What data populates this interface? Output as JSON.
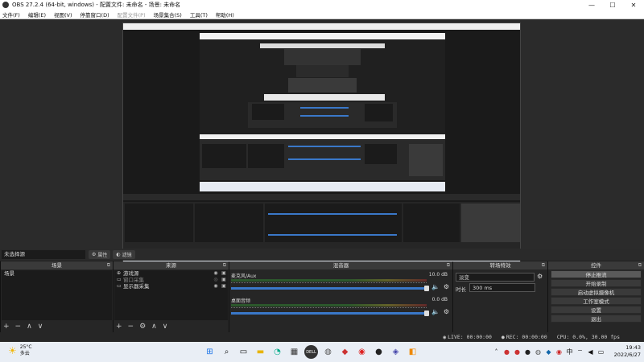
{
  "window": {
    "title": "OBS 27.2.4 (64-bit, windows) - 配置文件: 未命名 - 场景: 未命名",
    "controls": [
      "—",
      "☐",
      "✕"
    ]
  },
  "menu": {
    "items": [
      "文件(F)",
      "编辑(E)",
      "视图(V)",
      "停靠窗口(D)",
      "配置文件(P)",
      "场景集合(S)",
      "工具(T)",
      "帮助(H)"
    ]
  },
  "scene_bar": {
    "no_scene": "未选择源",
    "properties": "属性",
    "filters": "滤镜"
  },
  "docks": {
    "scenes": {
      "title": "场景",
      "items": [
        "场景"
      ]
    },
    "sources": {
      "title": "来源",
      "items": [
        {
          "label": "游戏源",
          "icon": "gamepad-icon"
        },
        {
          "label": "窗口采集",
          "icon": "window-icon"
        },
        {
          "label": "显示器采集",
          "icon": "monitor-icon"
        }
      ]
    },
    "mixer": {
      "title": "混音器",
      "tracks": [
        {
          "name": "麦克风/Aux",
          "db": "10.0 dB"
        },
        {
          "name": "桌面音频",
          "db": "0.0 dB"
        }
      ]
    },
    "transitions": {
      "title": "转场特效",
      "selected": "淡变",
      "duration_label": "时长",
      "duration_value": "300 ms"
    },
    "controls": {
      "title": "控件",
      "buttons": [
        "停止推流",
        "开始录制",
        "启动虚拟摄像机",
        "工作室模式",
        "设置",
        "退出"
      ]
    }
  },
  "status": {
    "live": "LIVE: 00:00:00",
    "rec": "REC: 00:00:00",
    "cpu": "CPU: 0.0%, 30.00 fps"
  },
  "taskbar": {
    "temperature": "25°C",
    "weather": "多云",
    "time": "19:43",
    "date": "2022/6/27"
  }
}
